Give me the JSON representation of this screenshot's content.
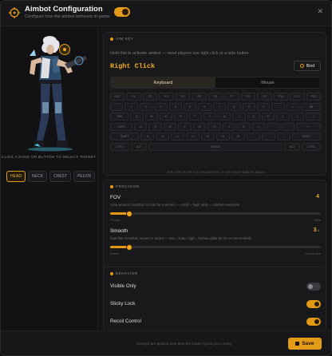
{
  "header": {
    "title": "Aimbot Configuration",
    "subtitle": "Configure how the aimbot behaves in-game",
    "enabled": true
  },
  "left": {
    "zone_hint": "CLICK A ZONE OR BUTTON TO SELECT TARGET",
    "zones": [
      "HEAD",
      "NECK",
      "CHEST",
      "PELVIS"
    ],
    "active_zone": "HEAD"
  },
  "aim_key": {
    "section_label": "AIM KEY",
    "description": "Hold this to activate aimbot — most players use right click or a side button",
    "value": "Right Click",
    "bind_label": "Bind",
    "tabs": [
      "Keyboard",
      "Mouse"
    ],
    "active_tab": "Keyboard",
    "keyboard_rows": [
      [
        "ESC",
        "F1",
        "F2",
        "F3",
        "F4",
        "F5",
        "F6",
        "F7",
        "F8",
        "F9",
        "F10",
        "F11",
        "F12"
      ],
      [
        "`",
        "1",
        "2",
        "3",
        "4",
        "5",
        "6",
        "7",
        "8",
        "9",
        "0",
        "-",
        "=",
        "⌫"
      ],
      [
        "TAB",
        "Q",
        "W",
        "E",
        "R",
        "T",
        "Y",
        "U",
        "I",
        "O",
        "P",
        "[",
        "]",
        "\\"
      ],
      [
        "CAPS",
        "A",
        "S",
        "D",
        "F",
        "G",
        "H",
        "J",
        "K",
        "L",
        ";",
        "'",
        "↵"
      ],
      [
        "SHIFT",
        "Z",
        "X",
        "C",
        "V",
        "B",
        "N",
        "M",
        ",",
        ".",
        "/",
        "SHIFT"
      ],
      [
        "CTRL",
        "ALT",
        "SPACE",
        "ALT",
        "CTRL"
      ]
    ],
    "keyboard_hint": "click a key to set it as your aim key, or use mouse buttons above"
  },
  "precision": {
    "section_label": "PRECISION",
    "fov": {
      "label": "FOV",
      "value": "4",
      "fraction": 0.09,
      "description": "Area around crosshair to look for enemies — small = legit, wide = catches everyone",
      "min_label": "Precise",
      "max_label": "Wide"
    },
    "smooth": {
      "label": "Smooth",
      "value": "3",
      "unit": "x",
      "fraction": 0.09,
      "description": "how fast crosshair moves to target — low = snap, high = human glide (8-15 recommended)",
      "min_label": "Instant",
      "max_label": "Human-like"
    }
  },
  "behavior": {
    "section_label": "BEHAVIOR",
    "items": [
      {
        "label": "Visible Only",
        "on": false
      },
      {
        "label": "Sticky Lock",
        "on": true
      },
      {
        "label": "Recoil Control",
        "on": true
      }
    ]
  },
  "footer": {
    "note": "changes are applied next time the loader syncs your config",
    "save_label": "Save"
  },
  "colors": {
    "accent": "#e39a16",
    "bg": "#141417",
    "card": "#19191c"
  }
}
